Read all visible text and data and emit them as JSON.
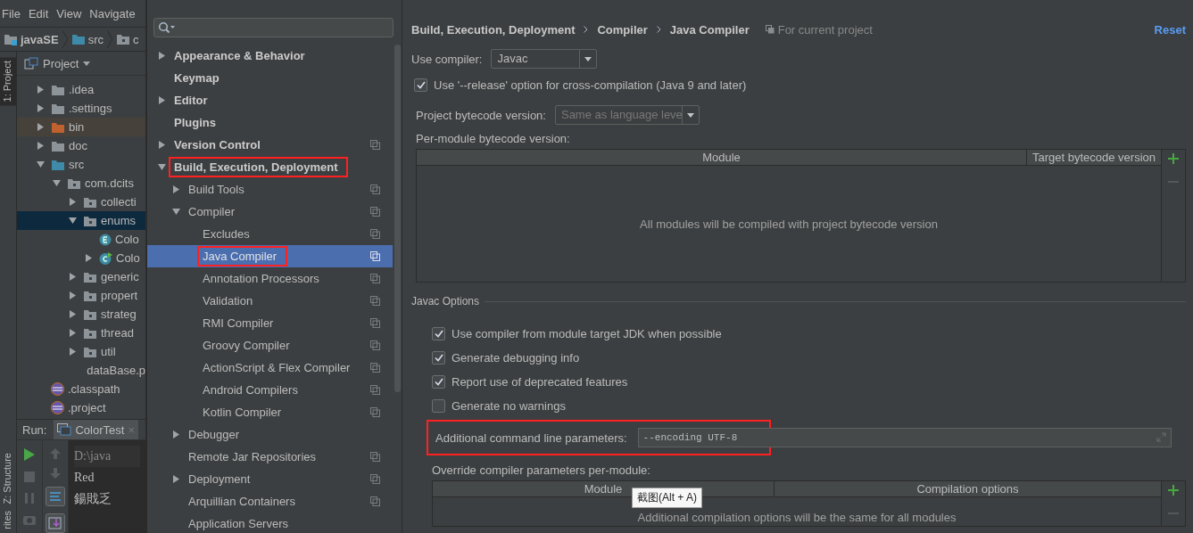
{
  "ide": {
    "menu": [
      "File",
      "Edit",
      "View",
      "Navigate"
    ],
    "navbar": [
      {
        "label": "javaSE",
        "kind": "module"
      },
      {
        "label": "src",
        "kind": "source"
      },
      {
        "label": "c",
        "kind": "package"
      }
    ],
    "tool_stripe": [
      {
        "label": "1: Project",
        "selected": true
      },
      {
        "label": "Z: Structure",
        "selected": false
      },
      {
        "label": "rites",
        "selected": false
      }
    ],
    "project_pane": {
      "title": "Project",
      "tree": [
        {
          "label": ".idea",
          "kind": "folder",
          "expanded": false,
          "selected": false
        },
        {
          "label": ".settings",
          "kind": "folder",
          "expanded": false,
          "selected": false
        },
        {
          "label": "bin",
          "kind": "excluded",
          "expanded": false,
          "selected": false
        },
        {
          "label": "doc",
          "kind": "folder",
          "expanded": false,
          "selected": false
        },
        {
          "label": "src",
          "kind": "source",
          "expanded": true,
          "selected": false,
          "children": [
            {
              "label": "com.dcits",
              "kind": "package",
              "expanded": true,
              "selected": false,
              "children": [
                {
                  "label": "collecti",
                  "kind": "package",
                  "expanded": false,
                  "selected": false
                },
                {
                  "label": "enums",
                  "kind": "package",
                  "expanded": true,
                  "selected": true,
                  "children": [
                    {
                      "label": "Colo",
                      "kind": "enum",
                      "selected": false
                    },
                    {
                      "label": "Colo",
                      "kind": "class",
                      "expanded": false,
                      "selected": false
                    }
                  ]
                },
                {
                  "label": "generic",
                  "kind": "package",
                  "expanded": false,
                  "selected": false
                },
                {
                  "label": "propert",
                  "kind": "package",
                  "expanded": false,
                  "selected": false
                },
                {
                  "label": "strateg",
                  "kind": "package",
                  "expanded": false,
                  "selected": false
                },
                {
                  "label": "thread",
                  "kind": "package",
                  "expanded": false,
                  "selected": false
                },
                {
                  "label": "util",
                  "kind": "package",
                  "expanded": false,
                  "selected": false
                },
                {
                  "label": "dataBase.p",
                  "kind": "properties",
                  "selected": false
                }
              ]
            }
          ]
        },
        {
          "label": ".classpath",
          "kind": "eclipse",
          "selected": false
        },
        {
          "label": ".project",
          "kind": "eclipse",
          "selected": false
        }
      ]
    },
    "run_panel": {
      "label": "Run:",
      "tab": "ColorTest",
      "close": "×",
      "console": [
        "D:\\java",
        "Red",
        "鍚戝乏"
      ]
    }
  },
  "settings": {
    "tree": [
      {
        "label": "Appearance & Behavior",
        "expanded": false,
        "project_scoped": false,
        "selected": false,
        "highlighted": false
      },
      {
        "label": "Keymap",
        "project_scoped": false,
        "selected": false,
        "highlighted": false
      },
      {
        "label": "Editor",
        "expanded": false,
        "project_scoped": false,
        "selected": false,
        "highlighted": false
      },
      {
        "label": "Plugins",
        "project_scoped": false,
        "selected": false,
        "highlighted": false
      },
      {
        "label": "Version Control",
        "expanded": false,
        "project_scoped": true,
        "selected": false,
        "highlighted": false
      },
      {
        "label": "Build, Execution, Deployment",
        "expanded": true,
        "project_scoped": false,
        "selected": false,
        "highlighted": true,
        "children": [
          {
            "label": "Build Tools",
            "expanded": false,
            "project_scoped": true,
            "selected": false,
            "highlighted": false
          },
          {
            "label": "Compiler",
            "expanded": true,
            "project_scoped": true,
            "selected": false,
            "highlighted": false,
            "children": [
              {
                "label": "Excludes",
                "project_scoped": true,
                "selected": false,
                "highlighted": false
              },
              {
                "label": "Java Compiler",
                "project_scoped": true,
                "selected": true,
                "highlighted": true
              },
              {
                "label": "Annotation Processors",
                "project_scoped": true,
                "selected": false,
                "highlighted": false
              },
              {
                "label": "Validation",
                "project_scoped": true,
                "selected": false,
                "highlighted": false
              },
              {
                "label": "RMI Compiler",
                "project_scoped": true,
                "selected": false,
                "highlighted": false
              },
              {
                "label": "Groovy Compiler",
                "project_scoped": true,
                "selected": false,
                "highlighted": false
              },
              {
                "label": "ActionScript & Flex Compiler",
                "project_scoped": true,
                "selected": false,
                "highlighted": false
              },
              {
                "label": "Android Compilers",
                "project_scoped": true,
                "selected": false,
                "highlighted": false
              },
              {
                "label": "Kotlin Compiler",
                "project_scoped": true,
                "selected": false,
                "highlighted": false
              }
            ]
          },
          {
            "label": "Debugger",
            "expanded": false,
            "project_scoped": false,
            "selected": false,
            "highlighted": false
          },
          {
            "label": "Remote Jar Repositories",
            "project_scoped": true,
            "selected": false,
            "highlighted": false
          },
          {
            "label": "Deployment",
            "expanded": false,
            "project_scoped": true,
            "selected": false,
            "highlighted": false
          },
          {
            "label": "Arquillian Containers",
            "project_scoped": true,
            "selected": false,
            "highlighted": false
          },
          {
            "label": "Application Servers",
            "project_scoped": false,
            "selected": false,
            "highlighted": false
          }
        ]
      }
    ],
    "breadcrumb": [
      "Build, Execution, Deployment",
      "Compiler",
      "Java Compiler"
    ],
    "scope_note": "For current project",
    "reset": "Reset",
    "use_compiler": {
      "label": "Use compiler:",
      "value": "Javac"
    },
    "release_option": {
      "label": "Use '--release' option for cross-compilation (Java 9 and later)",
      "checked": true
    },
    "project_bytecode": {
      "label": "Project bytecode version:",
      "value": "Same as language leve",
      "disabled": true
    },
    "per_module_table": {
      "title": "Per-module bytecode version:",
      "columns": [
        "Module",
        "Target bytecode version"
      ],
      "empty_text": "All modules will be compiled with project bytecode version"
    },
    "javac_options": {
      "title": "Javac Options",
      "checkboxes": [
        {
          "label": "Use compiler from module target JDK when possible",
          "checked": true
        },
        {
          "label": "Generate debugging info",
          "checked": true
        },
        {
          "label": "Report use of deprecated features",
          "checked": true
        },
        {
          "label": "Generate no warnings",
          "checked": false
        }
      ],
      "parameters": {
        "label": "Additional command line parameters:",
        "value": "--encoding UTF-8",
        "highlighted": true
      },
      "override_table": {
        "title": "Override compiler parameters per-module:",
        "columns": [
          "Module",
          "Compilation options"
        ],
        "empty_text": "Additional compilation options will be the same for all modules"
      }
    },
    "tooltip": "截图(Alt + A)"
  }
}
